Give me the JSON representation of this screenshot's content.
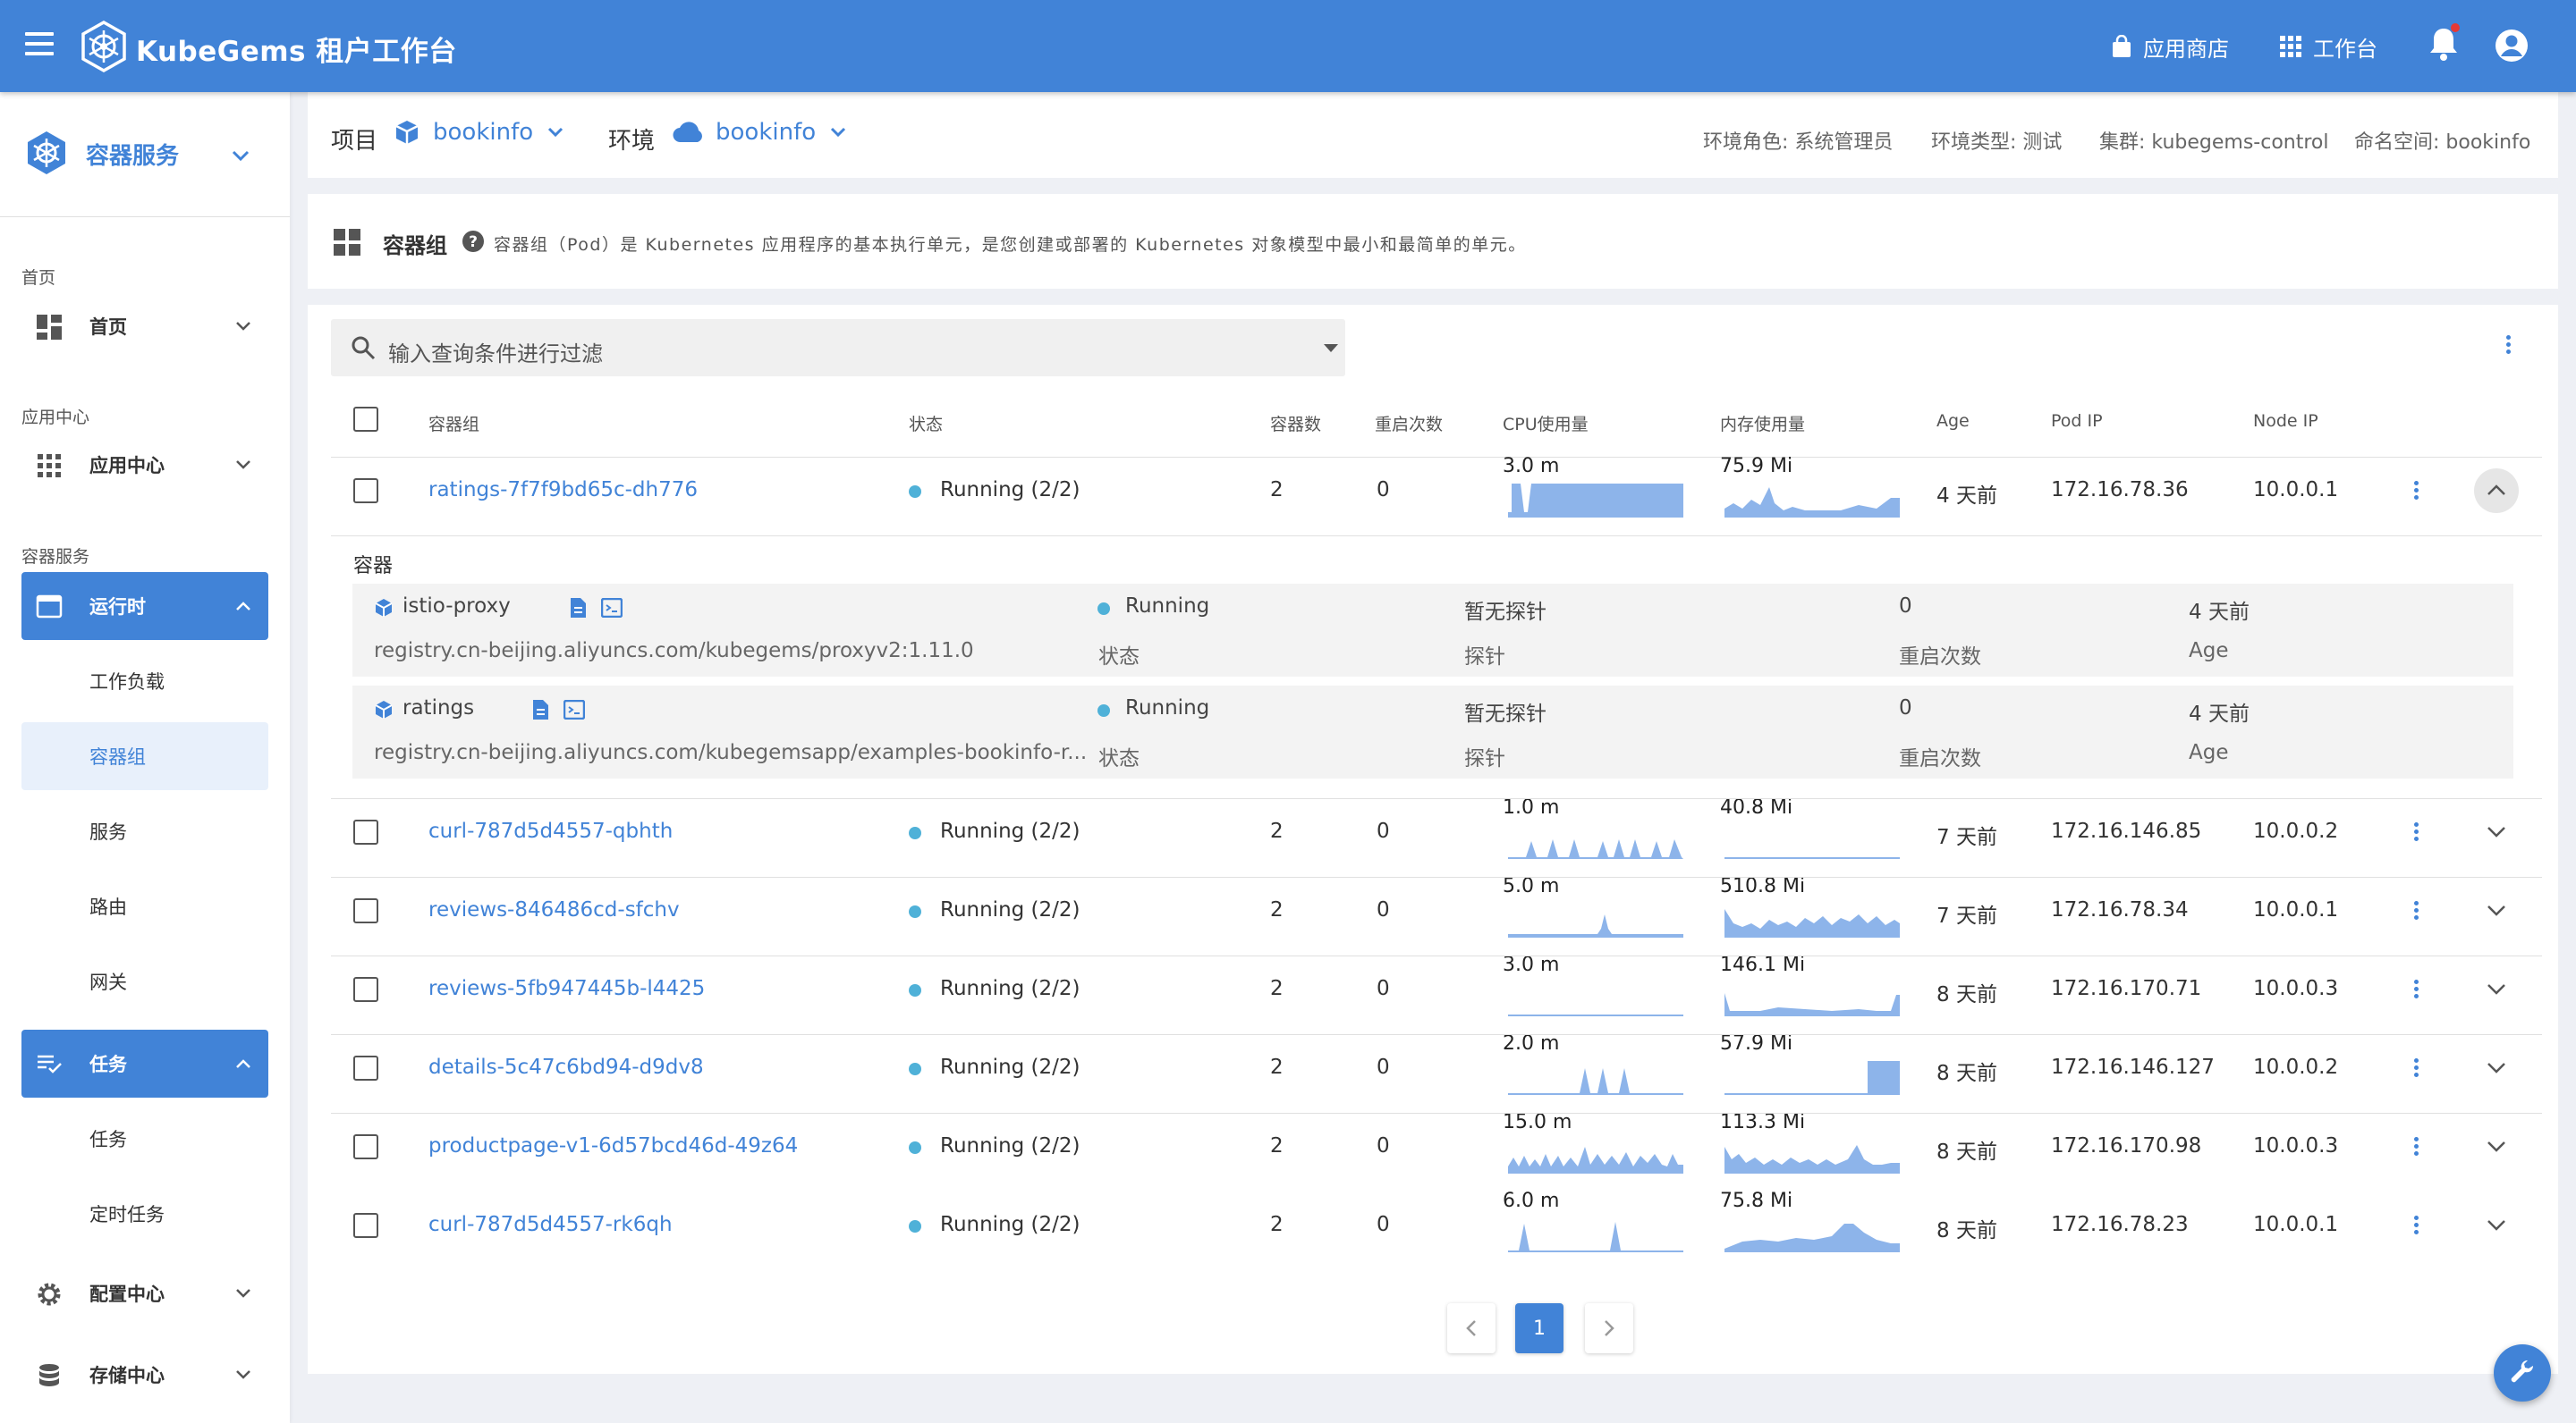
{
  "topbar": {
    "brand": "KubeGems 租户工作台",
    "app_store": "应用商店",
    "workbench": "工作台"
  },
  "sidebar": {
    "title": "容器服务",
    "sec_home": "首页",
    "home": "首页",
    "sec_app": "应用中心",
    "app": "应用中心",
    "sec_container": "容器服务",
    "runtime": "运行时",
    "workload": "工作负载",
    "pods": "容器组",
    "service": "服务",
    "route": "路由",
    "gateway": "网关",
    "tasks": "任务",
    "task": "任务",
    "cron": "定时任务",
    "config": "配置中心",
    "storage": "存储中心"
  },
  "envbar": {
    "project_label": "项目",
    "project": "bookinfo",
    "env_label": "环境",
    "env": "bookinfo",
    "role": "环境角色: 系统管理员",
    "type": "环境类型: 测试",
    "cluster": "集群: kubegems-control",
    "ns": "命名空间: bookinfo"
  },
  "titlebar": {
    "title": "容器组",
    "desc": "容器组（Pod）是 Kubernetes 应用程序的基本执行单元，是您创建或部署的 Kubernetes 对象模型中最小和最简单的单元。"
  },
  "search": {
    "placeholder": "输入查询条件进行过滤"
  },
  "table": {
    "headers": {
      "name": "容器组",
      "status": "状态",
      "count": "容器数",
      "restarts": "重启次数",
      "cpu": "CPU使用量",
      "mem": "内存使用量",
      "age": "Age",
      "podip": "Pod IP",
      "nodeip": "Node IP"
    },
    "rows": [
      {
        "name": "ratings-7f7f9bd65c-dh776",
        "status": "Running (2/2)",
        "count": "2",
        "restarts": "0",
        "cpu": "3.0 m",
        "mem": "75.9 Mi",
        "age": "4 天前",
        "podip": "172.16.78.36",
        "nodeip": "10.0.0.1"
      },
      {
        "name": "curl-787d5d4557-qbhth",
        "status": "Running (2/2)",
        "count": "2",
        "restarts": "0",
        "cpu": "1.0 m",
        "mem": "40.8 Mi",
        "age": "7 天前",
        "podip": "172.16.146.85",
        "nodeip": "10.0.0.2"
      },
      {
        "name": "reviews-846486cd-sfchv",
        "status": "Running (2/2)",
        "count": "2",
        "restarts": "0",
        "cpu": "5.0 m",
        "mem": "510.8 Mi",
        "age": "7 天前",
        "podip": "172.16.78.34",
        "nodeip": "10.0.0.1"
      },
      {
        "name": "reviews-5fb947445b-l4425",
        "status": "Running (2/2)",
        "count": "2",
        "restarts": "0",
        "cpu": "3.0 m",
        "mem": "146.1 Mi",
        "age": "8 天前",
        "podip": "172.16.170.71",
        "nodeip": "10.0.0.3"
      },
      {
        "name": "details-5c47c6bd94-d9dv8",
        "status": "Running (2/2)",
        "count": "2",
        "restarts": "0",
        "cpu": "2.0 m",
        "mem": "57.9 Mi",
        "age": "8 天前",
        "podip": "172.16.146.127",
        "nodeip": "10.0.0.2"
      },
      {
        "name": "productpage-v1-6d57bcd46d-49z64",
        "status": "Running (2/2)",
        "count": "2",
        "restarts": "0",
        "cpu": "15.0 m",
        "mem": "113.3 Mi",
        "age": "8 天前",
        "podip": "172.16.170.98",
        "nodeip": "10.0.0.3"
      },
      {
        "name": "curl-787d5d4557-rk6qh",
        "status": "Running (2/2)",
        "count": "2",
        "restarts": "0",
        "cpu": "6.0 m",
        "mem": "75.8 Mi",
        "age": "8 天前",
        "podip": "172.16.78.23",
        "nodeip": "10.0.0.1"
      }
    ]
  },
  "expanded": {
    "label": "容器",
    "containers": [
      {
        "name": "istio-proxy",
        "image": "registry.cn-beijing.aliyuncs.com/kubegems/proxyv2:1.11.0",
        "status": "Running",
        "status_label": "状态",
        "probe": "暂无探针",
        "probe_label": "探针",
        "restarts": "0",
        "restarts_label": "重启次数",
        "age": "4 天前",
        "age_label": "Age"
      },
      {
        "name": "ratings",
        "image": "registry.cn-beijing.aliyuncs.com/kubegemsapp/examples-bookinfo-r...",
        "status": "Running",
        "status_label": "状态",
        "probe": "暂无探针",
        "probe_label": "探针",
        "restarts": "0",
        "restarts_label": "重启次数",
        "age": "4 天前",
        "age_label": "Age"
      }
    ]
  },
  "pagination": {
    "page": "1"
  },
  "colors": {
    "primary": "#4183d7",
    "running": "#4fb1d8",
    "spark": "#8db4ea"
  }
}
